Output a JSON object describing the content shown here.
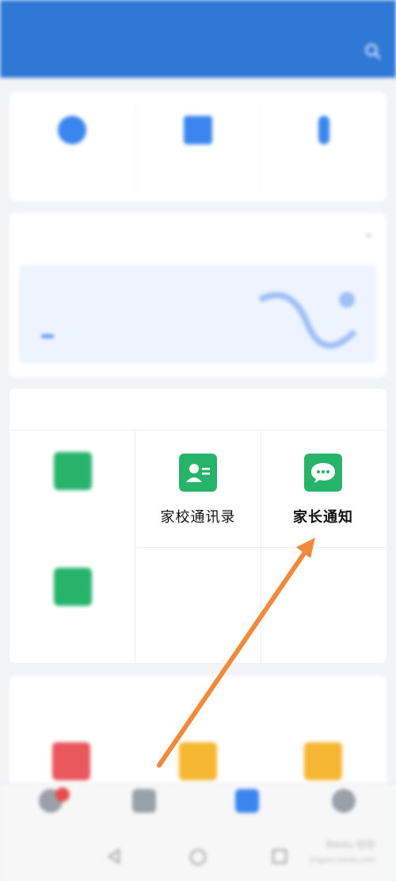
{
  "status_bar": {
    "left": "",
    "right": ""
  },
  "app_bar": {
    "title": "",
    "search_icon": "search-icon"
  },
  "quick_actions": [
    {
      "label": "",
      "icon": "circle-icon"
    },
    {
      "label": "",
      "icon": "grid-icon"
    },
    {
      "label": "",
      "icon": "thermometer-icon"
    }
  ],
  "banner_card": {
    "header": "",
    "line1": "",
    "line2": "",
    "button": ""
  },
  "school_section": {
    "header": "",
    "apps": [
      {
        "label": "",
        "icon": "app-icon",
        "color": "#27b36a"
      },
      {
        "label": "家校通讯录",
        "icon": "contact-card-icon",
        "color": "#27b36a"
      },
      {
        "label": "家长通知",
        "icon": "chat-bubble-icon",
        "color": "#27b36a"
      },
      {
        "label": "",
        "icon": "app-icon",
        "color": "#27b36a"
      }
    ]
  },
  "tools_section": {
    "header": "",
    "apps": [
      {
        "color": "#e8585d"
      },
      {
        "color": "#f5b731"
      },
      {
        "color": "#f5b731"
      }
    ]
  },
  "bottom_nav": [
    {
      "label": "",
      "icon": "message-icon",
      "badge": true
    },
    {
      "label": "",
      "icon": "contacts-icon"
    },
    {
      "label": "",
      "icon": "workbench-icon",
      "active": true
    },
    {
      "label": "",
      "icon": "profile-icon"
    }
  ],
  "watermark": {
    "text": "Baidu 经验",
    "sub": "jingyan.baidu.com"
  },
  "colors": {
    "primary": "#2f78d6",
    "green": "#27b36a",
    "arrow": "#f08a3c"
  }
}
